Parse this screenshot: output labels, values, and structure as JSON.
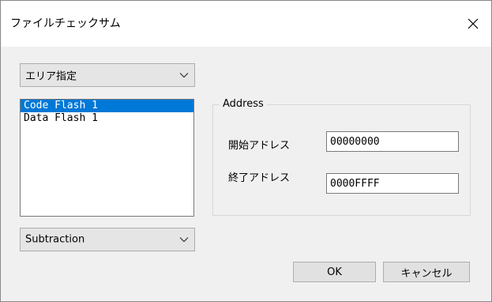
{
  "window": {
    "title": "ファイルチェックサム",
    "close_icon": "close-icon"
  },
  "area_select": {
    "value": "エリア指定",
    "icon": "chevron-down-icon"
  },
  "region_list": {
    "items": [
      {
        "label": "Code Flash 1",
        "selected": true
      },
      {
        "label": "Data Flash 1",
        "selected": false
      }
    ]
  },
  "method_select": {
    "value": "Subtraction",
    "icon": "chevron-down-icon"
  },
  "address_group": {
    "legend": "Address",
    "start_label": "開始アドレス",
    "start_value": "00000000",
    "end_label": "終了アドレス",
    "end_value": "0000FFFF"
  },
  "buttons": {
    "ok": "OK",
    "cancel": "キャンセル"
  },
  "colors": {
    "selection": "#0078d7",
    "dialog_bg": "#f0f0f0",
    "titlebar_bg": "#ffffff"
  }
}
